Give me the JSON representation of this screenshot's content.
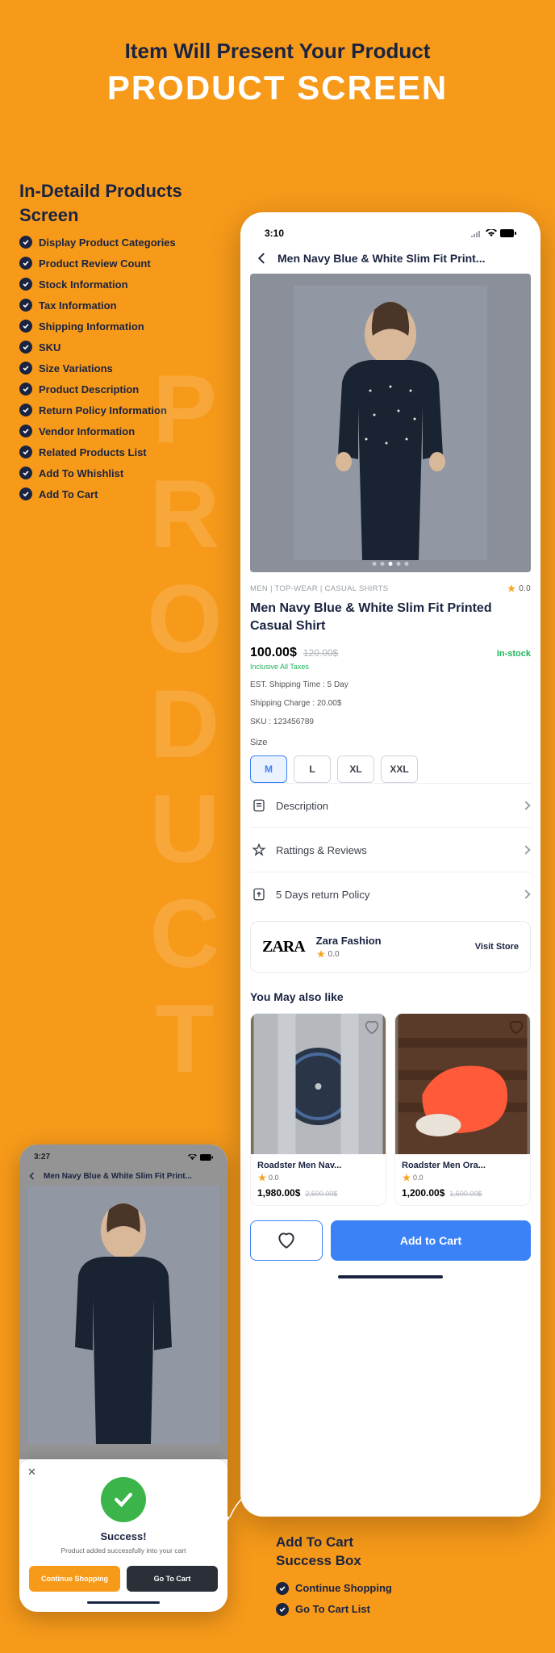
{
  "hero": {
    "subtitle": "Item Will Present Your Product",
    "title": "PRODUCT SCREEN"
  },
  "side": {
    "heading1": "In-Detaild Products",
    "heading2": "Screen",
    "features": [
      "Display Product Categories",
      "Product Review Count",
      "Stock Information",
      "Tax Information",
      "Shipping Information",
      "SKU",
      "Size Variations",
      "Product Description",
      "Return Policy Information",
      "Vendor Information",
      "Related Products List",
      "Add To Whishlist",
      "Add To Cart"
    ]
  },
  "watermark": "PRODUCT",
  "phone": {
    "time": "3:10",
    "title": "Men Navy Blue & White Slim Fit Print...",
    "breadcrumb": "MEN | TOP-WEAR | CASUAL SHIRTS",
    "rating_top": "0.0",
    "product_title": "Men Navy Blue & White Slim Fit Printed Casual Shirt",
    "price": "100.00$",
    "old_price": "120.00$",
    "stock": "In-stock",
    "tax_note": "Inclusive All Taxes",
    "shipping_time": "EST. Shipping Time : 5 Day",
    "shipping_charge": "Shipping Charge : 20.00$",
    "sku": "SKU : 123456789",
    "size_label": "Size",
    "sizes": [
      "M",
      "L",
      "XL",
      "XXL"
    ],
    "acc_description": "Description",
    "acc_ratings": "Rattings & Reviews",
    "acc_return": "5 Days return Policy",
    "vendor": {
      "logo": "ZARA",
      "name": "Zara Fashion",
      "rating": "0.0",
      "visit": "Visit Store"
    },
    "related_title": "You May also like",
    "related": [
      {
        "title": "Roadster Men Nav...",
        "rating": "0.0",
        "price": "1,980.00$",
        "old": "2,500.00$",
        "img_color": "#9ea4a9"
      },
      {
        "title": "Roadster Men Ora...",
        "rating": "0.0",
        "price": "1,200.00$",
        "old": "1,500.00$",
        "img_color": "#5a3a28"
      }
    ],
    "add_cart": "Add to Cart"
  },
  "small_phone": {
    "time": "3:27",
    "title": "Men Navy Blue & White Slim Fit Print...",
    "modal": {
      "success": "Success!",
      "message": "Product added successfully into your cart",
      "continue": "Continue Shopping",
      "goto": "Go To Cart"
    }
  },
  "right": {
    "heading1": "Add To Cart",
    "heading2": "Success Box",
    "items": [
      "Continue Shopping",
      "Go To Cart List"
    ]
  }
}
